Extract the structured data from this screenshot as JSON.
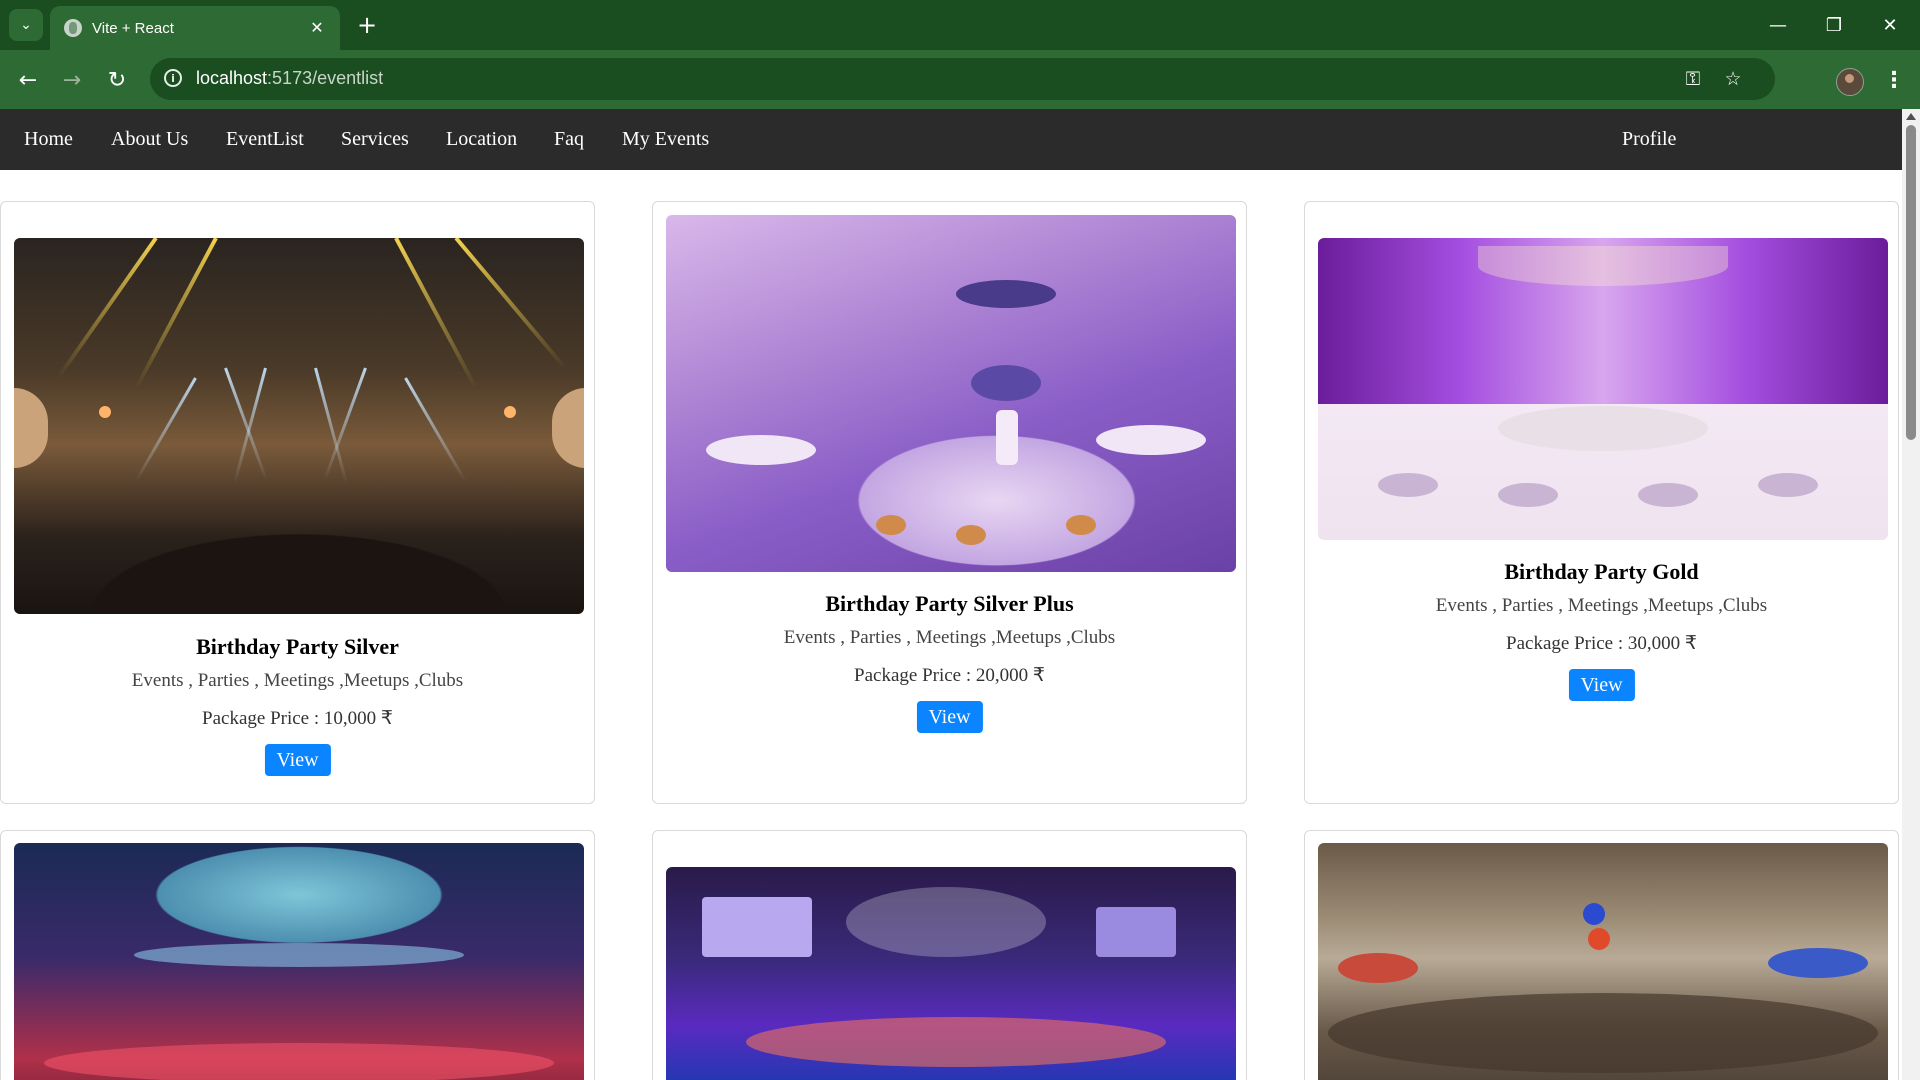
{
  "browser": {
    "tab_title": "Vite + React",
    "url_host": "localhost",
    "url_path": ":5173/eventlist",
    "icons": [
      "tab-search-icon",
      "globe-icon",
      "close-icon",
      "new-tab-icon",
      "minimize-icon",
      "restore-icon",
      "window-close-icon",
      "back-icon",
      "forward-icon",
      "reload-icon",
      "site-info-icon",
      "password-key-icon",
      "bookmark-star-icon",
      "profile-avatar",
      "menu-kebab-icon"
    ],
    "glyphs": {
      "tab_menu": "⌄",
      "tab_close": "✕",
      "new_tab": "+",
      "minimize": "—",
      "restore": "❐",
      "window_close": "✕",
      "back": "←",
      "forward": "→",
      "reload": "↻",
      "info": "i",
      "key": "⚿",
      "star": "☆",
      "kebab": "⋮"
    }
  },
  "nav": {
    "items": [
      "Home",
      "About Us",
      "EventList",
      "Services",
      "Location",
      "Faq",
      "My Events"
    ],
    "profile": "Profile"
  },
  "cards": [
    {
      "title": "Birthday Party Silver",
      "tags": "Events , Parties , Meetings ,Meetups ,Clubs",
      "price": "Package Price : 10,000 ₹",
      "button": "View"
    },
    {
      "title": "Birthday Party Silver Plus",
      "tags": "Events , Parties , Meetings ,Meetups ,Clubs",
      "price": "Package Price : 20,000 ₹",
      "button": "View"
    },
    {
      "title": "Birthday Party Gold",
      "tags": "Events , Parties , Meetings ,Meetups ,Clubs",
      "price": "Package Price : 30,000 ₹",
      "button": "View"
    }
  ],
  "colors": {
    "tabstrip": "#1a4d1f",
    "toolbar": "#2e6a33",
    "navbar": "#2b2b2b",
    "view_button": "#0a84ff"
  }
}
